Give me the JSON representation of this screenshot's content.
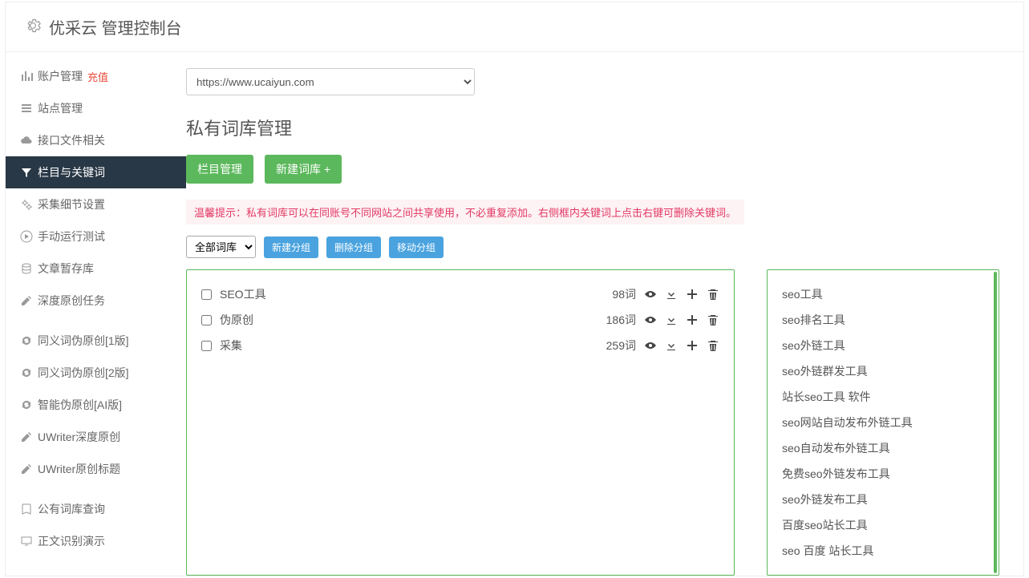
{
  "header": {
    "title": "优采云 管理控制台"
  },
  "sidebar": {
    "items": [
      {
        "label": "账户管理",
        "badge": "充值"
      },
      {
        "label": "站点管理"
      },
      {
        "label": "接口文件相关"
      },
      {
        "label": "栏目与关键词"
      },
      {
        "label": "采集细节设置"
      },
      {
        "label": "手动运行测试"
      },
      {
        "label": "文章暂存库"
      },
      {
        "label": "深度原创任务"
      }
    ],
    "group2": [
      {
        "label": "同义词伪原创[1版]"
      },
      {
        "label": "同义词伪原创[2版]"
      },
      {
        "label": "智能伪原创[AI版]"
      },
      {
        "label": "UWriter深度原创"
      },
      {
        "label": "UWriter原创标题"
      }
    ],
    "group3": [
      {
        "label": "公有词库查询"
      },
      {
        "label": "正文识别演示"
      }
    ]
  },
  "main": {
    "url": "https://www.ucaiyun.com",
    "title": "私有词库管理",
    "btn_category": "栏目管理",
    "btn_new_lib": "新建词库 +",
    "tip": "温馨提示：私有词库可以在同账号不同网站之间共享使用，不必重复添加。右侧框内关键词上点击右键可删除关键词。",
    "group_select": "全部词库",
    "btn_new_group": "新建分组",
    "btn_del_group": "删除分组",
    "btn_move_group": "移动分组",
    "libs": [
      {
        "name": "SEO工具",
        "count": "98词"
      },
      {
        "name": "伪原创",
        "count": "186词"
      },
      {
        "name": "采集",
        "count": "259词"
      }
    ],
    "keywords": [
      "seo工具",
      "seo排名工具",
      "seo外链工具",
      "seo外链群发工具",
      "站长seo工具 软件",
      "seo网站自动发布外链工具",
      "seo自动发布外链工具",
      "免费seo外链发布工具",
      "seo外链发布工具",
      "百度seo站长工具",
      "seo 百度 站长工具"
    ]
  }
}
